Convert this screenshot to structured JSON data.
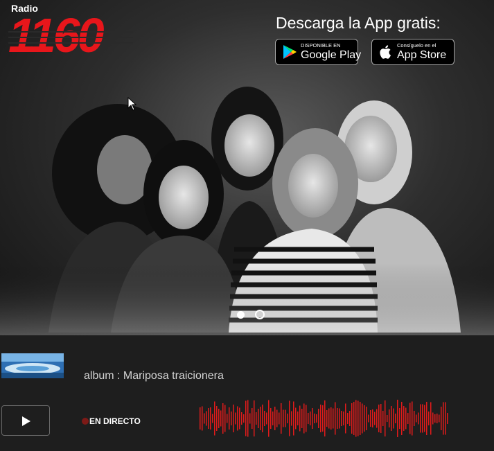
{
  "brand": {
    "radio_label": "Radio",
    "number": "1160",
    "color": "#e8161b"
  },
  "promo": {
    "title": "Descarga la App gratis:",
    "google_play": {
      "small": "DISPONIBLE EN",
      "big": "Google Play",
      "icon": "google-play-icon"
    },
    "app_store": {
      "small": "Consíguelo en el",
      "big": "App Store",
      "icon": "apple-icon"
    }
  },
  "carousel": {
    "slide_count": 2,
    "active_index": 0
  },
  "player": {
    "album_text": "album : Mariposa traicionera",
    "live_text": "EN DIRECTO",
    "live_color": "#7d1a17",
    "wave_color": "#e01b1b",
    "play_icon": "play-icon"
  }
}
